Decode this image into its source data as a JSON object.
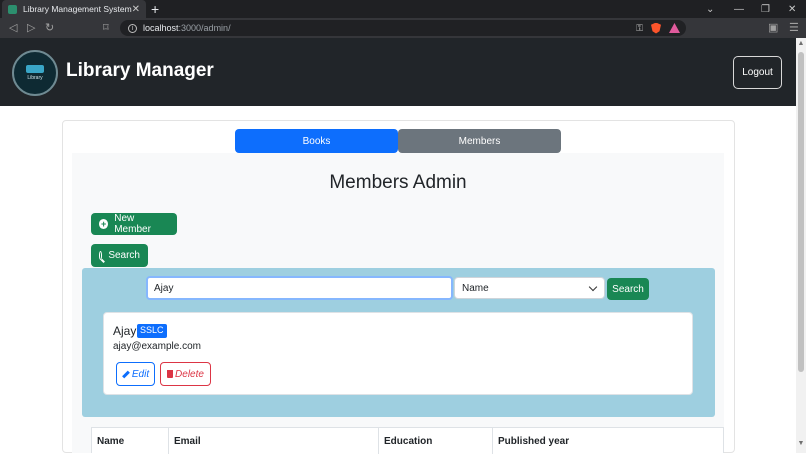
{
  "browser": {
    "tab_title": "Library Management System",
    "url_host": "localhost",
    "url_path": ":3000/admin/"
  },
  "header": {
    "logo_text": "Library",
    "brand": "Library Manager",
    "logout_label": "Logout"
  },
  "nav": {
    "books_label": "Books",
    "members_label": "Members"
  },
  "page": {
    "title": "Members Admin",
    "new_member_label": "New Member",
    "search_toggle_label": "Search"
  },
  "search": {
    "query": "Ajay",
    "field_selected": "Name",
    "submit_label": "Search"
  },
  "result": {
    "name": "Ajay",
    "badge": "SSLC",
    "email": "ajay@example.com",
    "edit_label": "Edit",
    "delete_label": "Delete"
  },
  "table": {
    "columns": [
      "Name",
      "Email",
      "Education",
      "Published year"
    ]
  },
  "colors": {
    "primary": "#0d6efd",
    "secondary": "#6c757d",
    "success": "#198754",
    "danger": "#dc3545",
    "header_bg": "#212529",
    "search_area": "#9ecfe0"
  }
}
